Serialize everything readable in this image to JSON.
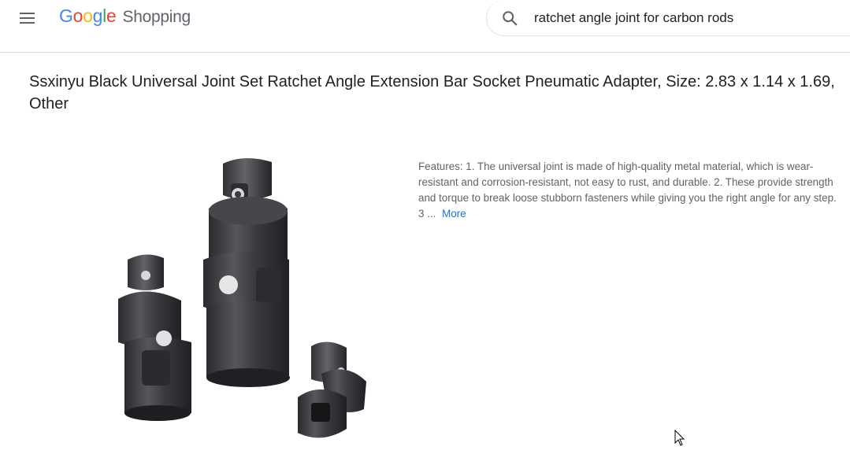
{
  "header": {
    "logo": {
      "letters": [
        "G",
        "o",
        "o",
        "g",
        "l",
        "e"
      ],
      "product": "Shopping"
    },
    "menu_icon": "hamburger-menu-icon",
    "search": {
      "icon": "search-icon",
      "value": "ratchet angle joint for carbon rods"
    }
  },
  "product": {
    "title": "Ssxinyu Black Universal Joint Set Ratchet Angle Extension Bar Socket Pneumatic Adapter, Size: 2.83 x 1.14 x 1.69, Other",
    "image_alt": "Product image of three black universal joint socket adapters",
    "description": "Features: 1. The universal joint is made of high-quality metal material, which is wear-resistant and corrosion-resistant, not easy to rust, and durable. 2. These provide strength and torque to break loose stubborn fasteners while giving you the right angle for any step. 3 ...",
    "more_label": "More"
  },
  "colors": {
    "google_blue": "#4285f4",
    "google_red": "#ea4335",
    "google_yellow": "#fbbc05",
    "google_green": "#34a853",
    "link": "#1a73e8",
    "text_secondary": "#5f6368"
  }
}
